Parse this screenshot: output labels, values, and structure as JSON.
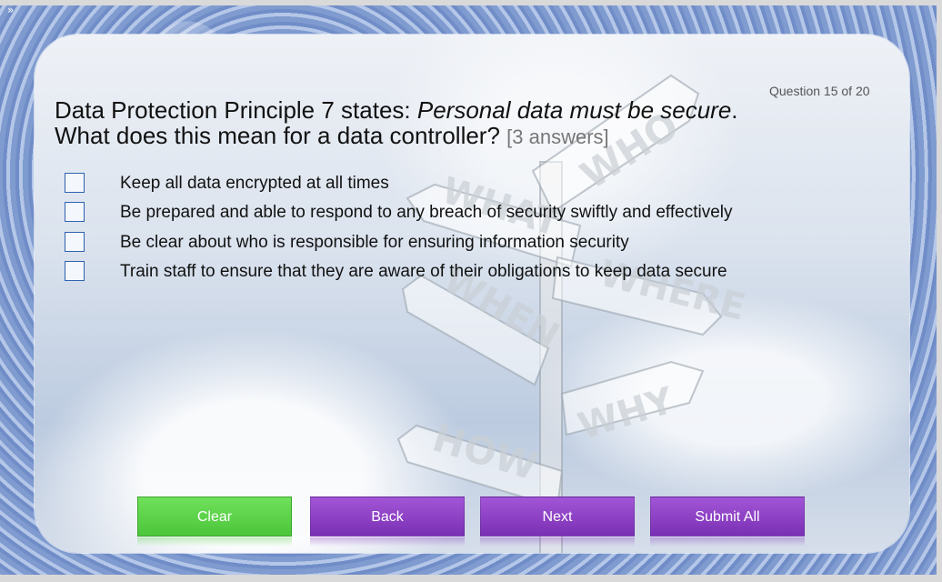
{
  "window": {
    "expand_glyph": "»"
  },
  "quiz": {
    "counter": "Question 15 of 20",
    "question_prefix": "Data Protection Principle 7 states: ",
    "question_italic": "Personal data must be secure",
    "question_suffix": ". What does this mean for a data controller? ",
    "hint": "[3 answers]",
    "options": [
      {
        "label": "Keep all data encrypted at all times",
        "checked": false
      },
      {
        "label": "Be prepared and able to respond to any breach of security swiftly and effectively",
        "checked": false
      },
      {
        "label": "Be clear about who is responsible for ensuring information security",
        "checked": false
      },
      {
        "label": "Train staff to ensure that they are aware of their obligations to keep data secure",
        "checked": false
      }
    ]
  },
  "signpost": {
    "words": [
      "WHO",
      "WHAT",
      "WHERE",
      "WHEN",
      "WHY",
      "HOW"
    ]
  },
  "buttons": {
    "clear": "Clear",
    "back": "Back",
    "next": "Next",
    "submit": "Submit All"
  },
  "colors": {
    "clear_button": "#5cd44a",
    "nav_button": "#8b3fc4",
    "checkbox_border": "#2e62b0"
  }
}
